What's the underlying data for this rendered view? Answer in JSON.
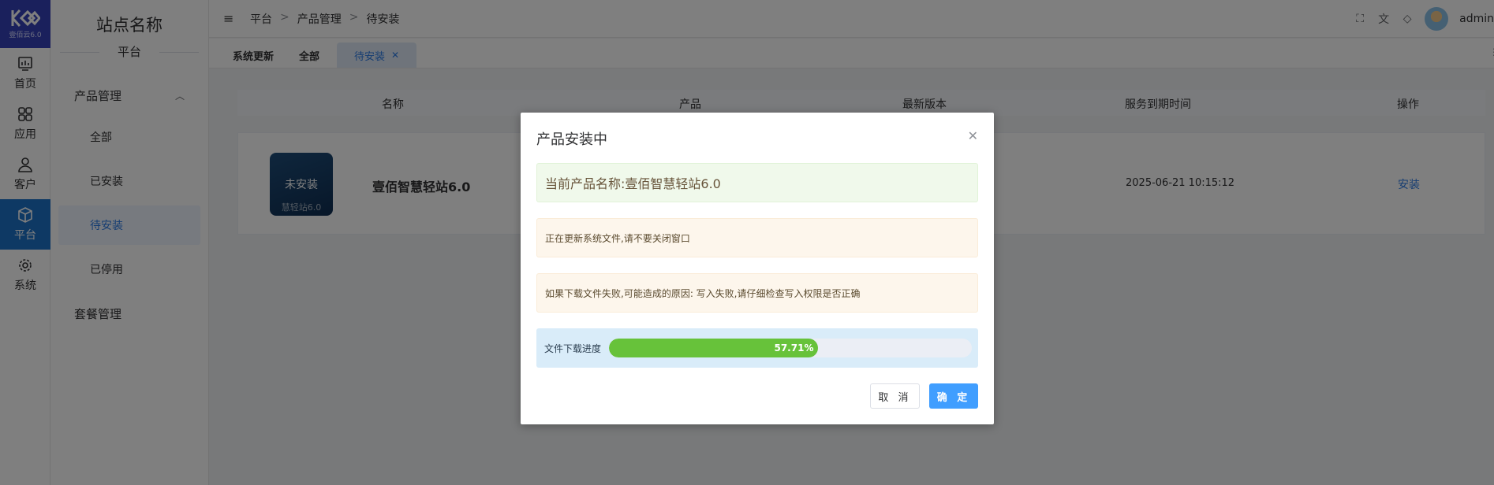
{
  "rail": {
    "logo_version": "壹佰云6.0",
    "items": [
      {
        "label": "首页",
        "icon": "dashboard-icon"
      },
      {
        "label": "应用",
        "icon": "grid-icon"
      },
      {
        "label": "客户",
        "icon": "user-icon"
      },
      {
        "label": "平台",
        "icon": "cube-icon"
      },
      {
        "label": "系统",
        "icon": "gear-icon"
      }
    ],
    "active": "平台",
    "active_color": "#1d73c9"
  },
  "menu": {
    "site_title": "站点名称",
    "section": "平台",
    "group_label": "产品管理",
    "children": [
      "全部",
      "已安装",
      "待安装",
      "已停用"
    ],
    "active_child": "待安装",
    "root_item": "套餐管理"
  },
  "header": {
    "breadcrumbs": [
      "平台",
      "产品管理",
      "待安装"
    ],
    "user": "admin"
  },
  "tabs": {
    "items": [
      "系统更新",
      "全部",
      "待安装"
    ],
    "active": "待安装"
  },
  "table": {
    "headers": [
      "名称",
      "产品",
      "最新版本",
      "服务到期时间",
      "操作"
    ],
    "row": {
      "image_text": "未安装",
      "image_subtext": "慧轻站6.0",
      "name": "壹佰智慧轻站6.0",
      "expire": "2025-06-21 10:15:12",
      "action": "安装"
    }
  },
  "dialog": {
    "title": "产品安装中",
    "product_line": "当前产品名称:壹佰智慧轻站6.0",
    "notice1": "正在更新系统文件,请不要关闭窗口",
    "notice2": "如果下载文件失败,可能造成的原因: 写入失败,请仔细检查写入权限是否正确",
    "progress_label": "文件下载进度",
    "progress_percent": 57.71,
    "progress_text": "57.71%",
    "cancel_label": "取 消",
    "ok_label": "确 定",
    "accent": "#409eff",
    "progress_color": "#67c23a"
  }
}
